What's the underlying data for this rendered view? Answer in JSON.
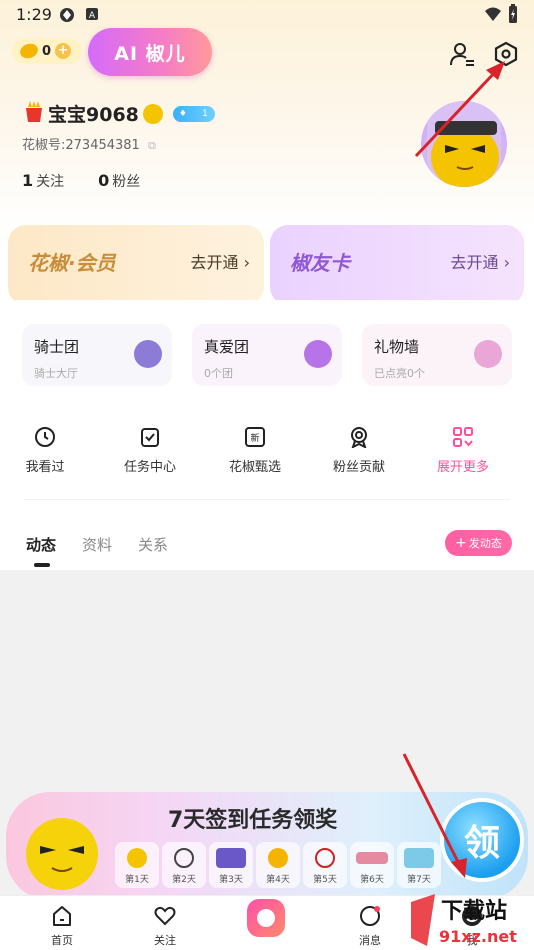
{
  "status": {
    "time": "1:29"
  },
  "header": {
    "coin_count": "0",
    "ai_label": "AI 椒儿"
  },
  "profile": {
    "name": "宝宝9068",
    "level": "1",
    "id_text": "花椒号:273454381",
    "following_count": "1",
    "following_label": "关注",
    "fans_count": "0",
    "fans_label": "粉丝"
  },
  "promo": {
    "member_title": "花椒·会员",
    "member_link": "去开通",
    "card_title": "椒友卡",
    "card_link": "去开通"
  },
  "cards": [
    {
      "title": "骑士团",
      "sub": "骑士大厅"
    },
    {
      "title": "真爱团",
      "sub": "0个团"
    },
    {
      "title": "礼物墙",
      "sub": "已点亮0个"
    }
  ],
  "grid": [
    {
      "label": "我看过"
    },
    {
      "label": "任务中心"
    },
    {
      "label": "花椒甄选"
    },
    {
      "label": "粉丝贡献"
    },
    {
      "label": "展开更多"
    }
  ],
  "tabs": [
    {
      "label": "动态"
    },
    {
      "label": "资料"
    },
    {
      "label": "关系"
    }
  ],
  "post_button": "发动态",
  "banner": {
    "title": "7天签到任务领奖",
    "claim": "领",
    "days": [
      "第1天",
      "第2天",
      "第3天",
      "第4天",
      "第5天",
      "第6天",
      "第7天"
    ]
  },
  "bottom_nav": [
    {
      "label": "首页"
    },
    {
      "label": "关注"
    },
    {
      "label": "消息"
    },
    {
      "label": "我"
    }
  ],
  "watermark": {
    "site": "下载站",
    "url": "91xz.net"
  },
  "colors": {
    "accent_pink": "#ff5fa0",
    "ai_gradient": "#d46bfa",
    "member_gold": "#c98d3a",
    "card_purple": "#8e58d6",
    "annotation_red": "#d8232a"
  }
}
